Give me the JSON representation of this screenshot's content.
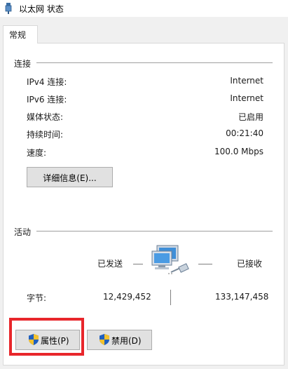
{
  "window": {
    "title": "以太网 状态",
    "tab": "常规"
  },
  "connection": {
    "section_label": "连接",
    "rows": [
      {
        "label": "IPv4 连接:",
        "value": "Internet"
      },
      {
        "label": "IPv6 连接:",
        "value": "Internet"
      },
      {
        "label": "媒体状态:",
        "value": "已启用"
      },
      {
        "label": "持续时间:",
        "value": "00:21:40"
      },
      {
        "label": "速度:",
        "value": "100.0 Mbps"
      }
    ],
    "details_button": "详细信息(E)..."
  },
  "activity": {
    "section_label": "活动",
    "sent_label": "已发送",
    "received_label": "已接收",
    "bytes_label": "字节:",
    "bytes_sent": "12,429,452",
    "bytes_received": "133,147,458"
  },
  "buttons": {
    "properties": "属性(P)",
    "disable": "禁用(D)"
  },
  "icons": {
    "title": "network-adapter-icon",
    "activity": "network-computers-icon",
    "shield": "uac-shield-icon"
  }
}
